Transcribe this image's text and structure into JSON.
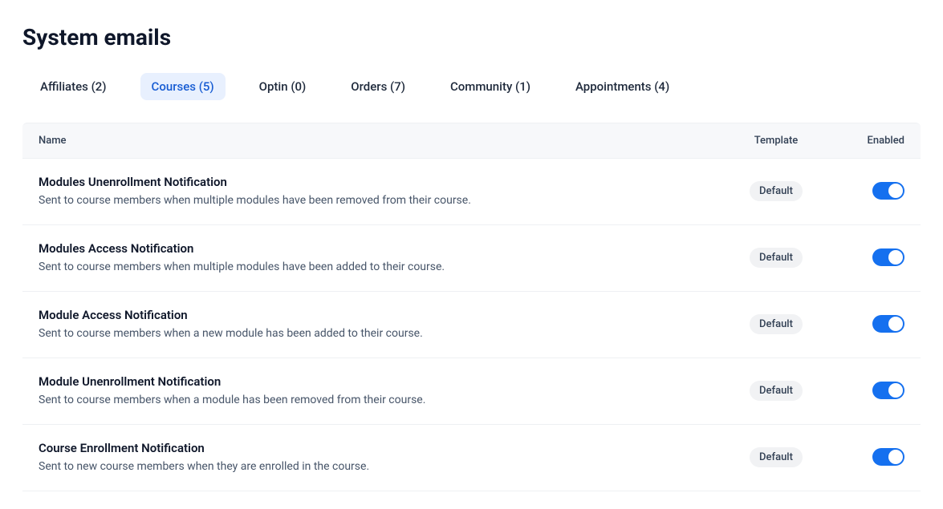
{
  "page_title": "System emails",
  "tabs": [
    {
      "label": "Affiliates (2)",
      "active": false
    },
    {
      "label": "Courses (5)",
      "active": true
    },
    {
      "label": "Optin (0)",
      "active": false
    },
    {
      "label": "Orders (7)",
      "active": false
    },
    {
      "label": "Community (1)",
      "active": false
    },
    {
      "label": "Appointments (4)",
      "active": false
    }
  ],
  "columns": {
    "name": "Name",
    "template": "Template",
    "enabled": "Enabled"
  },
  "rows": [
    {
      "title": "Modules Unenrollment Notification",
      "desc": "Sent to course members when multiple modules have been removed from their course.",
      "template": "Default",
      "enabled": true
    },
    {
      "title": "Modules Access Notification",
      "desc": "Sent to course members when multiple modules have been added to their course.",
      "template": "Default",
      "enabled": true
    },
    {
      "title": "Module Access Notification",
      "desc": "Sent to course members when a new module has been added to their course.",
      "template": "Default",
      "enabled": true
    },
    {
      "title": "Module Unenrollment Notification",
      "desc": "Sent to course members when a module has been removed from their course.",
      "template": "Default",
      "enabled": true
    },
    {
      "title": "Course Enrollment Notification",
      "desc": "Sent to new course members when they are enrolled in the course.",
      "template": "Default",
      "enabled": true
    }
  ]
}
